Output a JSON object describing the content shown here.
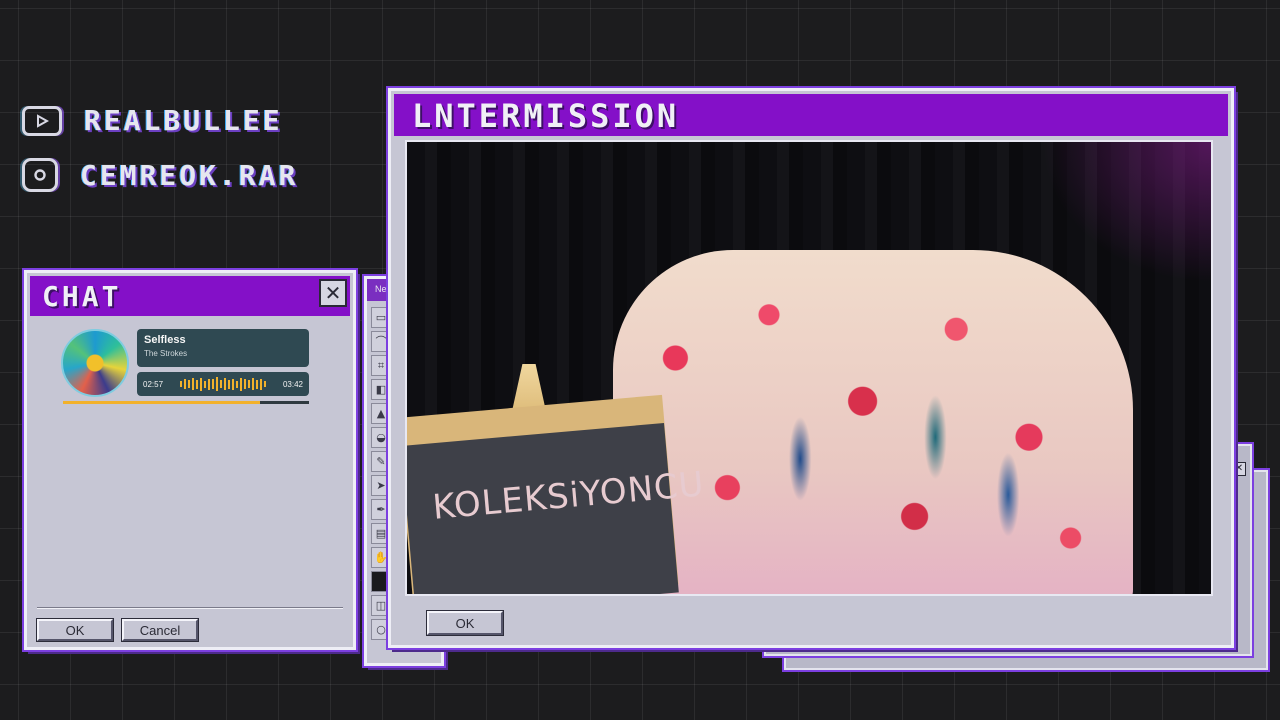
{
  "socials": {
    "youtube": {
      "handle": "REALBULLEE",
      "icon": "youtube-icon"
    },
    "instagram": {
      "handle": "CEMREOK.RAR",
      "icon": "instagram-icon"
    }
  },
  "chat_window": {
    "title": "CHAT",
    "close_label": "✕",
    "player": {
      "track": "Selfless",
      "artist": "The Strokes",
      "elapsed": "02:57",
      "total": "03:42",
      "progress": 0.8
    },
    "ok_label": "OK",
    "cancel_label": "Cancel"
  },
  "tools_window": {
    "title": "Ne"
  },
  "intermission_window": {
    "title": "LNTERMISSION",
    "board_text": "KOLEKSiYONCU",
    "ok_label": "OK"
  },
  "colors": {
    "title_bar": "#8410c8",
    "window_body": "#c6c6d4",
    "accent": "#f2b12b",
    "background": "#1c1c1e"
  }
}
